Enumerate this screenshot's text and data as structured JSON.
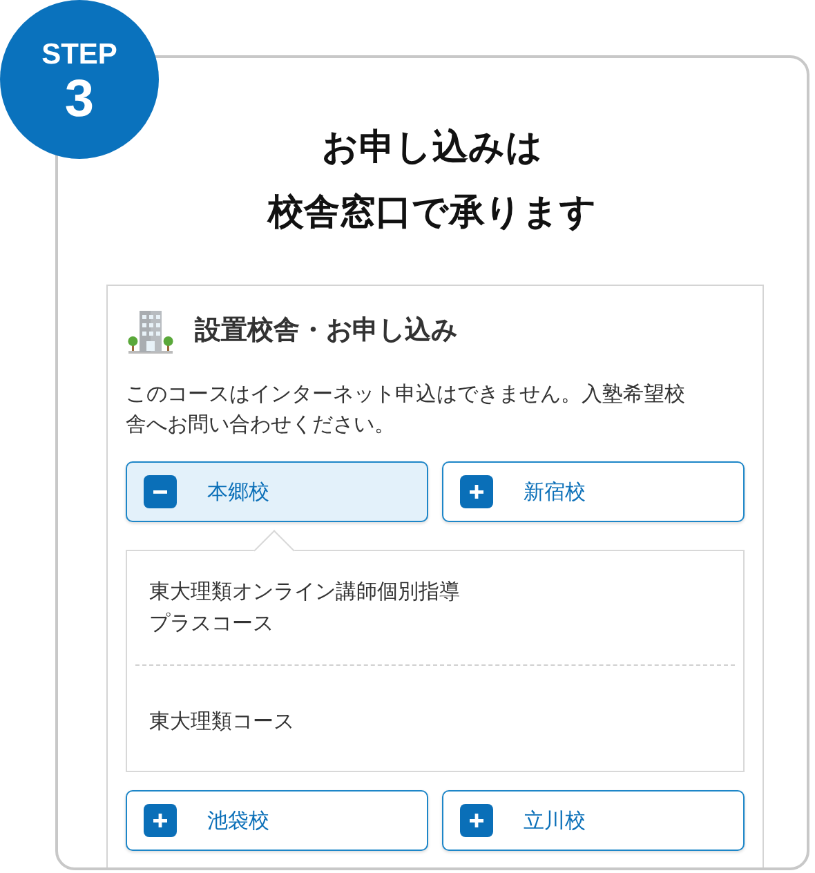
{
  "step": {
    "label": "STEP",
    "number": "3"
  },
  "title_lines": [
    "お申し込みは",
    "校舎窓口で承ります"
  ],
  "section": {
    "heading": "設置校舎・お申し込み",
    "description": "このコースはインターネット申込はできません。入塾希望校舎へお問い合わせください。"
  },
  "campuses": [
    {
      "name": "本郷校",
      "expanded": true,
      "courses": [
        "東大理類オンライン講師個別指導プラスコース",
        "東大理類コース"
      ]
    },
    {
      "name": "新宿校",
      "expanded": false
    },
    {
      "name": "池袋校",
      "expanded": false
    },
    {
      "name": "立川校",
      "expanded": false
    }
  ]
}
